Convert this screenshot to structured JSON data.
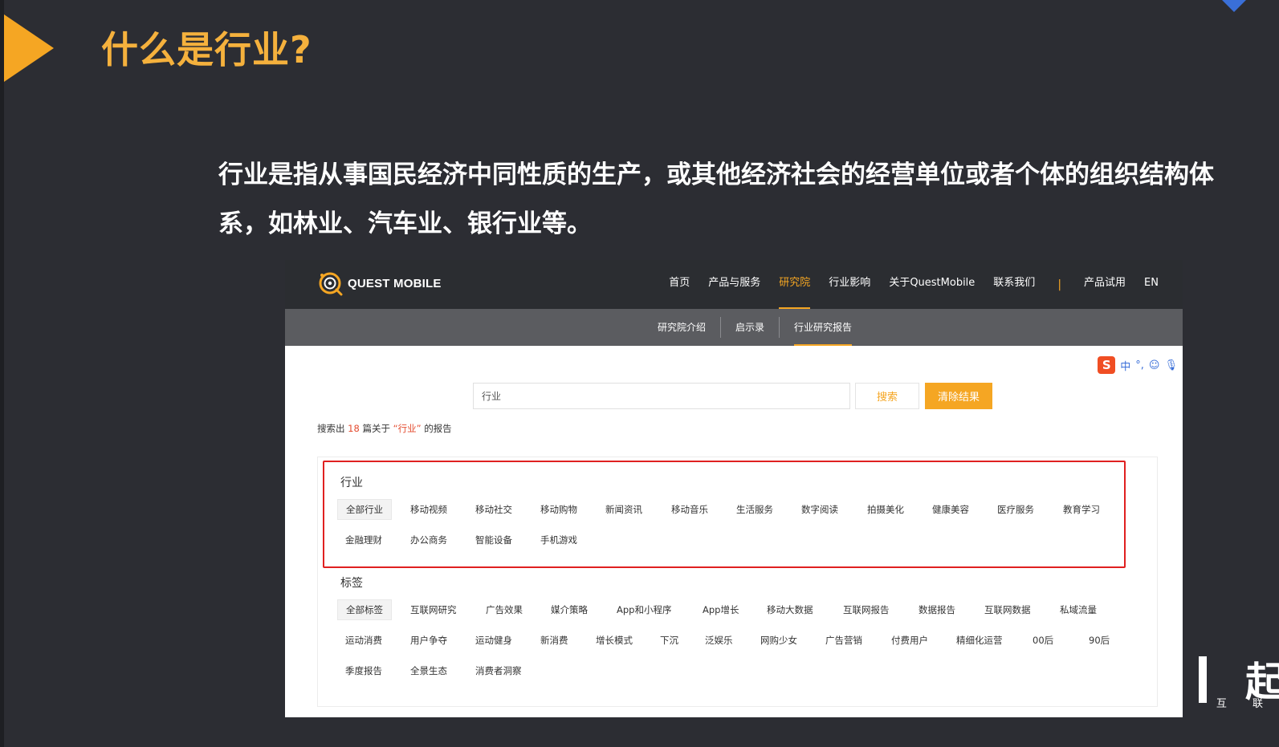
{
  "slide": {
    "title": "什么是行业?",
    "body": "行业是指从事国民经济中同性质的生产，或其他经济社会的经营单位或者个体的组织结构体系，如林业、汽车业、银行业等。"
  },
  "site": {
    "logo_text": "QUEST MOBILE",
    "nav": [
      "首页",
      "产品与服务",
      "研究院",
      "行业影响",
      "关于QuestMobile",
      "联系我们"
    ],
    "nav_separator": "|",
    "nav_right": [
      "产品试用",
      "EN"
    ],
    "active_nav": "研究院",
    "subnav": [
      "研究院介绍",
      "启示录",
      "行业研究报告"
    ],
    "active_subnav": "行业研究报告"
  },
  "ime": {
    "logo": "S",
    "items": [
      "中",
      "°,",
      "☺",
      "🎙"
    ]
  },
  "search": {
    "value": "行业",
    "search_label": "搜索",
    "clear_label": "清除结果",
    "result_prefix": "搜索出",
    "result_count": "18",
    "result_mid": "篇关于",
    "result_keyword": "“行业”",
    "result_suffix": "的报告"
  },
  "industry": {
    "title": "行业",
    "row1": [
      "全部行业",
      "移动视频",
      "移动社交",
      "移动购物",
      "新闻资讯",
      "移动音乐",
      "生活服务",
      "数字阅读",
      "拍摄美化",
      "健康美容",
      "医疗服务",
      "教育学习"
    ],
    "row2": [
      "金融理财",
      "办公商务",
      "智能设备",
      "手机游戏"
    ]
  },
  "tags": {
    "title": "标签",
    "row1": [
      "全部标签",
      "互联网研究",
      "广告效果",
      "媒介策略",
      "App和小程序",
      "App增长",
      "移动大数据",
      "互联网报告",
      "数据报告",
      "互联网数据",
      "私域流量"
    ],
    "row2": [
      "运动消费",
      "用户争夺",
      "运动健身",
      "新消费",
      "增长模式",
      "下沉",
      "泛娱乐",
      "网购少女",
      "广告营销",
      "付费用户",
      "精细化运营",
      "00后",
      "90后"
    ],
    "row3": [
      "季度报告",
      "全景生态",
      "消费者洞察"
    ]
  },
  "brand": {
    "big": "起",
    "small": "互 联"
  },
  "colors": {
    "accent": "#f5a623",
    "background": "#2c2d33",
    "highlight": "#e02020"
  }
}
